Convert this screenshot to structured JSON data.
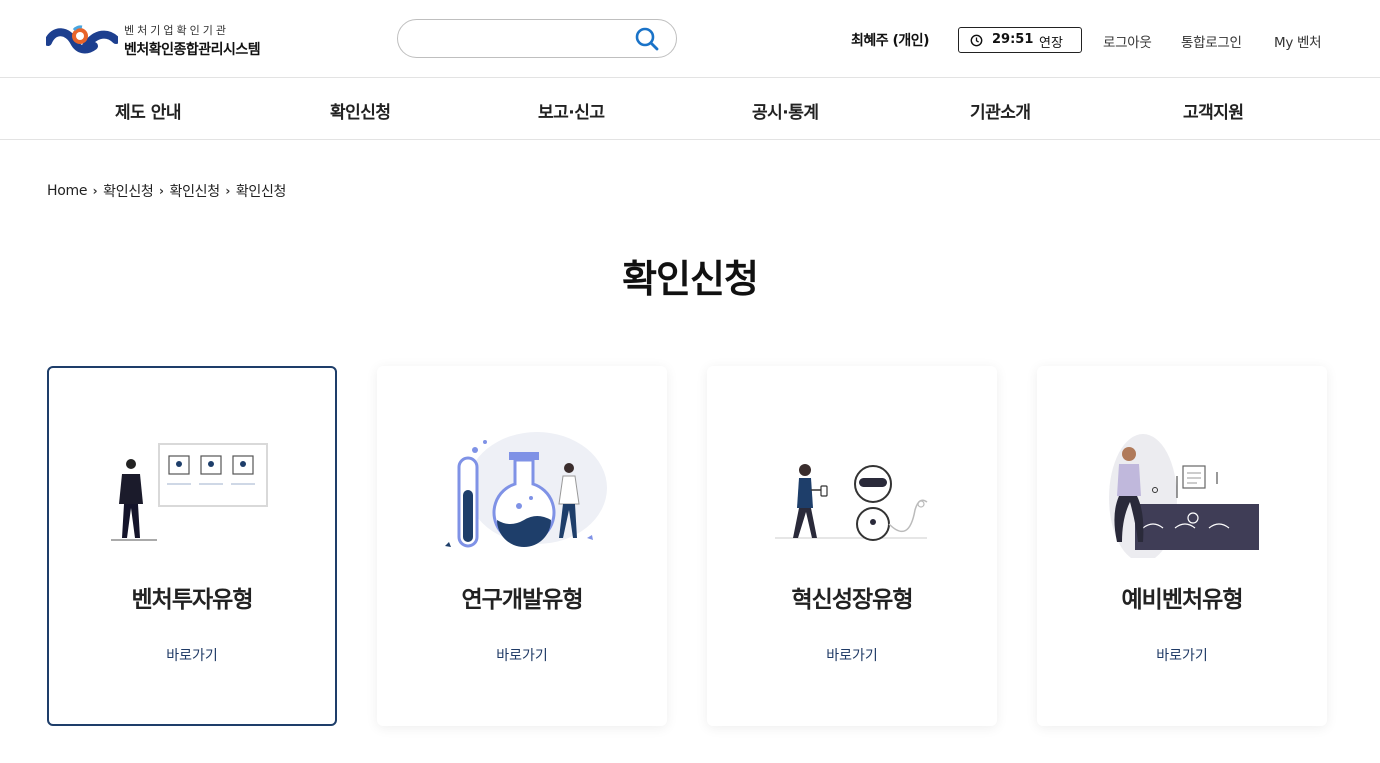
{
  "header": {
    "logo_sub": "벤처기업확인기관",
    "logo_main": "벤처확인종합관리시스템",
    "search": {
      "placeholder": "",
      "value": ""
    },
    "user_name": "최혜주 (개인)",
    "timer": {
      "time": "29:51",
      "extend_label": "연장"
    },
    "links": {
      "logout": "로그아웃",
      "integrated_login": "통합로그인",
      "my_venture": "My 벤처"
    }
  },
  "gnb": [
    "제도 안내",
    "확인신청",
    "보고·신고",
    "공시·통계",
    "기관소개",
    "고객지원"
  ],
  "breadcrumb": [
    "Home",
    "확인신청",
    "확인신청",
    "확인신청"
  ],
  "page_title": "확인신청",
  "cards": [
    {
      "title": "벤처투자유형",
      "link": "바로가기",
      "icon": "venture-investment-illustration"
    },
    {
      "title": "연구개발유형",
      "link": "바로가기",
      "icon": "research-lab-illustration"
    },
    {
      "title": "혁신성장유형",
      "link": "바로가기",
      "icon": "robot-innovation-illustration"
    },
    {
      "title": "예비벤처유형",
      "link": "바로가기",
      "icon": "pre-venture-illustration"
    }
  ],
  "colors": {
    "accent": "#1e3e6a",
    "link": "#1f3a66",
    "brand_blue": "#1d3f8f",
    "brand_orange": "#e8642a"
  }
}
